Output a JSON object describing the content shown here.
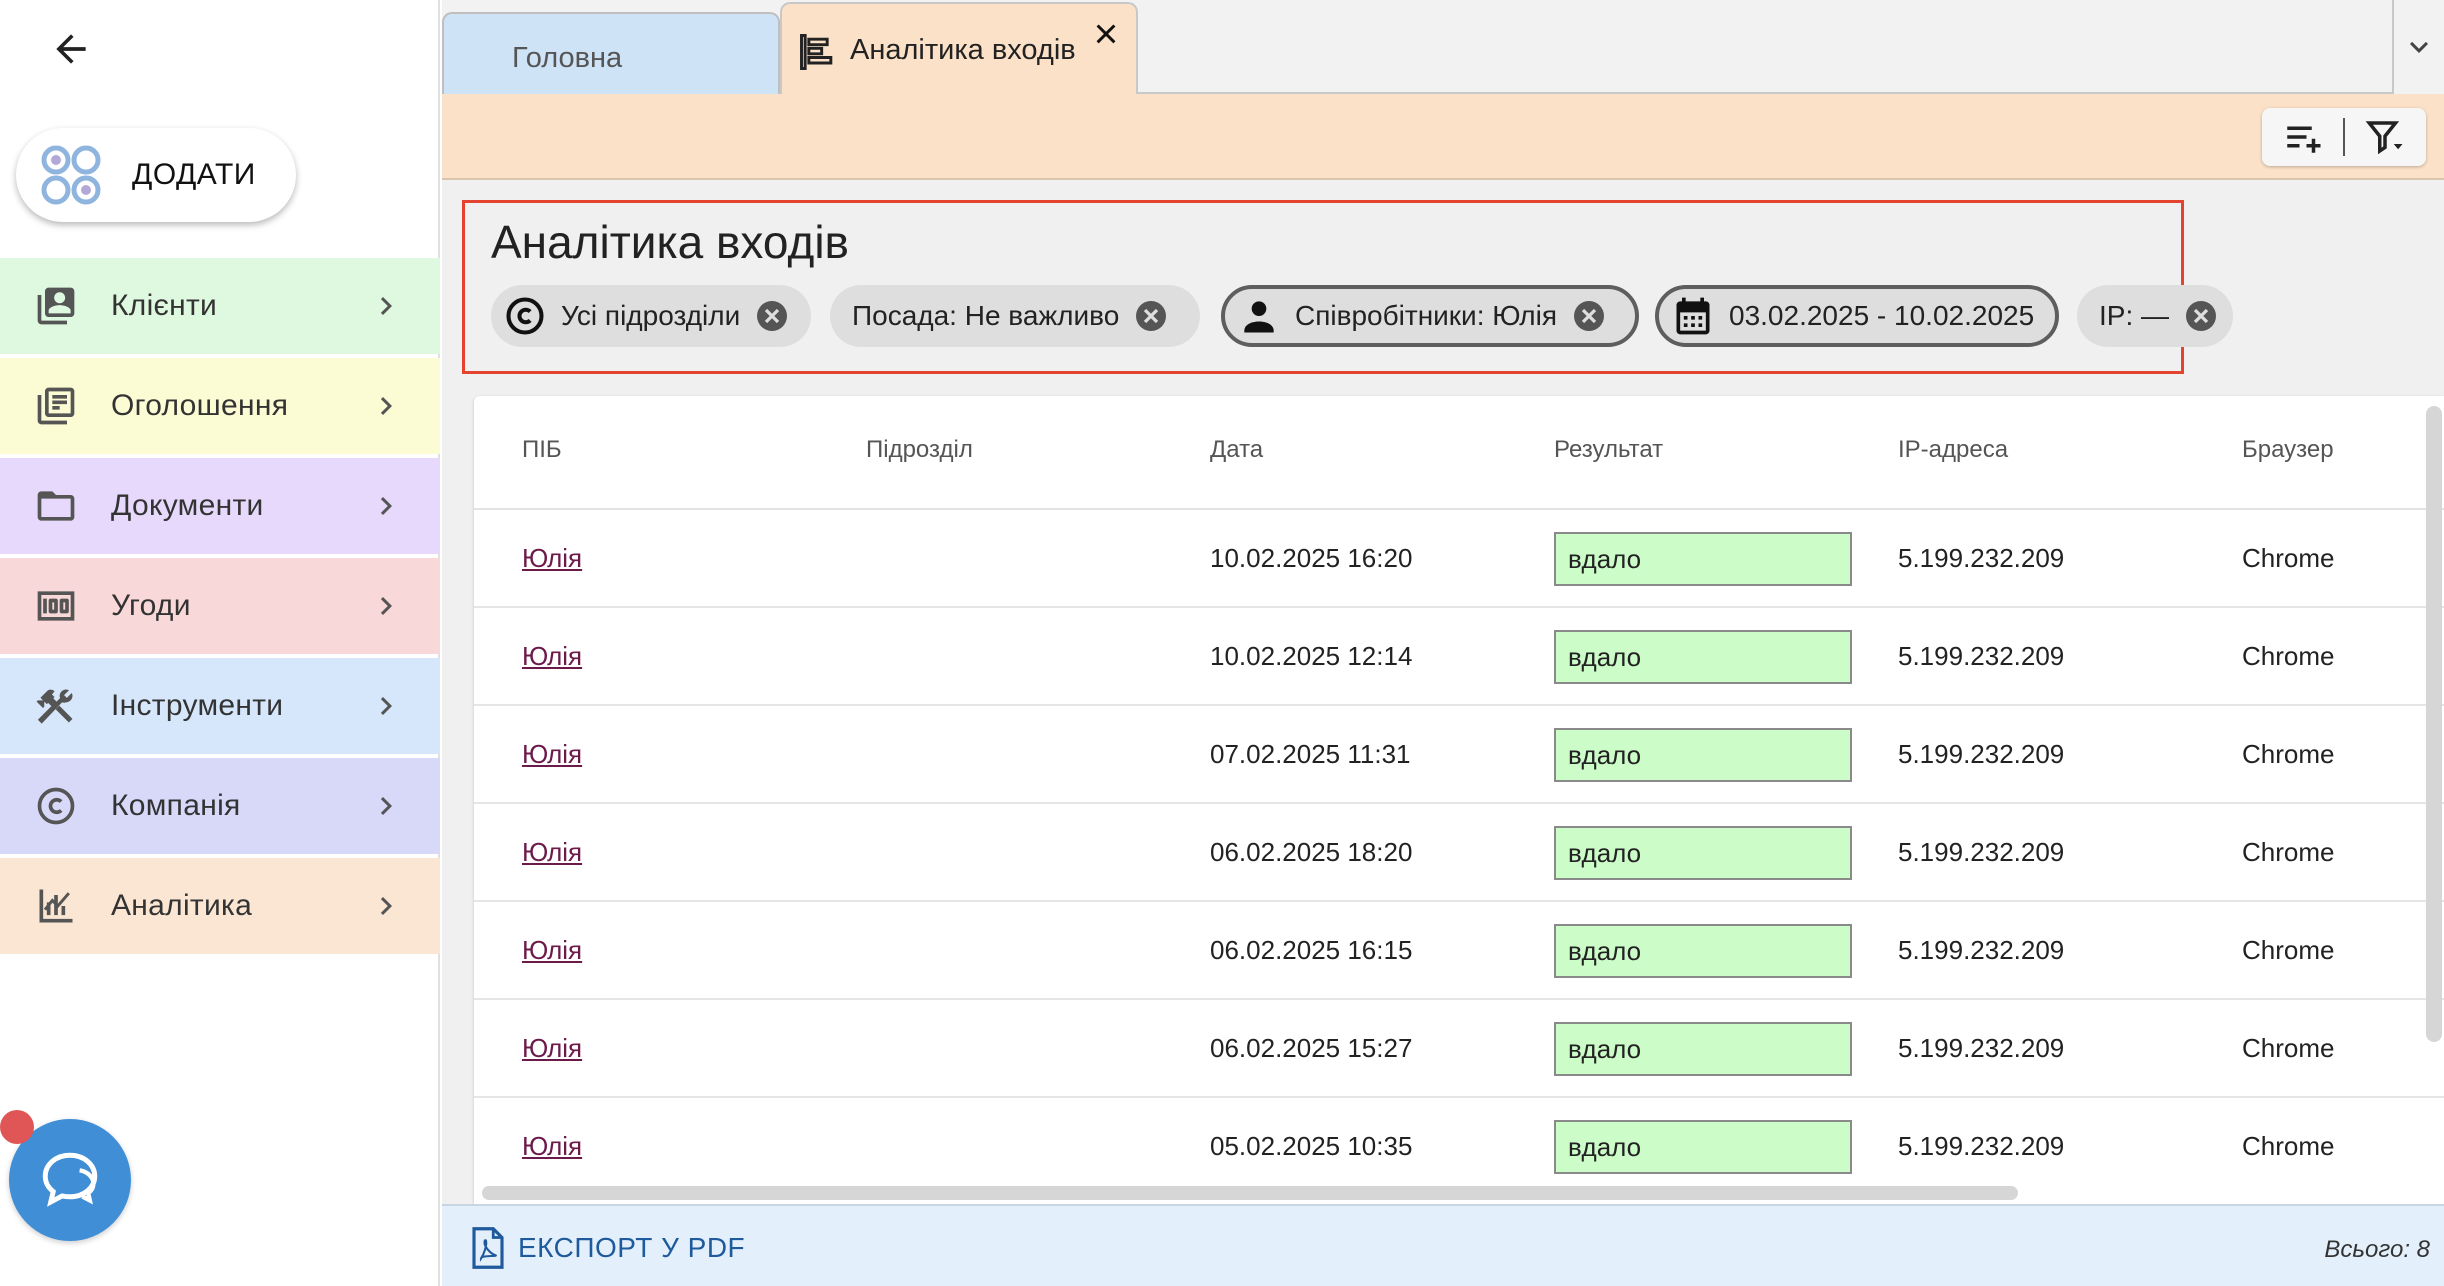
{
  "sidebar": {
    "add_label": "ДОДАТИ",
    "items": [
      {
        "label": "Клієнти",
        "icon": "contacts-icon",
        "bg": "#dff8e0"
      },
      {
        "label": "Оголошення",
        "icon": "listings-icon",
        "bg": "#fbfbd4"
      },
      {
        "label": "Документи",
        "icon": "folder-icon",
        "bg": "#e6d9fb"
      },
      {
        "label": "Угоди",
        "icon": "money-icon",
        "bg": "#f8d8d8"
      },
      {
        "label": "Інструменти",
        "icon": "tools-icon",
        "bg": "#d6e7fb"
      },
      {
        "label": "Компанія",
        "icon": "copyright-icon",
        "bg": "#d8d8f8"
      },
      {
        "label": "Аналітика",
        "icon": "analytics-icon",
        "bg": "#fbe6d4"
      }
    ]
  },
  "tabs": [
    {
      "label": "Головна",
      "active": false
    },
    {
      "label": "Аналітика входів",
      "active": true
    }
  ],
  "page": {
    "title": "Аналітика входів",
    "filters": {
      "department": "Усі підрозділи",
      "position": "Посада: Не важливо",
      "employees": "Співробітники: Юлія",
      "date_range": "03.02.2025 - 10.02.2025",
      "ip": "IP: —"
    }
  },
  "table": {
    "columns": [
      "ПІБ",
      "Підрозділ",
      "Дата",
      "Результат",
      "IP-адреса",
      "Браузер"
    ],
    "rows": [
      {
        "name": "Юлія",
        "department": "",
        "date": "10.02.2025 16:20",
        "result": "вдало",
        "ip": "5.199.232.209",
        "browser": "Chrome"
      },
      {
        "name": "Юлія",
        "department": "",
        "date": "10.02.2025 12:14",
        "result": "вдало",
        "ip": "5.199.232.209",
        "browser": "Chrome"
      },
      {
        "name": "Юлія",
        "department": "",
        "date": "07.02.2025 11:31",
        "result": "вдало",
        "ip": "5.199.232.209",
        "browser": "Chrome"
      },
      {
        "name": "Юлія",
        "department": "",
        "date": "06.02.2025 18:20",
        "result": "вдало",
        "ip": "5.199.232.209",
        "browser": "Chrome"
      },
      {
        "name": "Юлія",
        "department": "",
        "date": "06.02.2025 16:15",
        "result": "вдало",
        "ip": "5.199.232.209",
        "browser": "Chrome"
      },
      {
        "name": "Юлія",
        "department": "",
        "date": "06.02.2025 15:27",
        "result": "вдало",
        "ip": "5.199.232.209",
        "browser": "Chrome"
      },
      {
        "name": "Юлія",
        "department": "",
        "date": "05.02.2025 10:35",
        "result": "вдало",
        "ip": "5.199.232.209",
        "browser": "Chrome"
      }
    ]
  },
  "footer": {
    "export_label": "ЕКСПОРТ У PDF",
    "total": "Всього: 8"
  },
  "colors": {
    "accent_border": "#e2442f",
    "tab_active": "#fbe1c7",
    "tab_inactive": "#cfe3f7",
    "result_ok": "#ccfcc8",
    "link": "#6b1a4a",
    "export": "#1f5a9c",
    "chat": "#3f8ed6"
  }
}
